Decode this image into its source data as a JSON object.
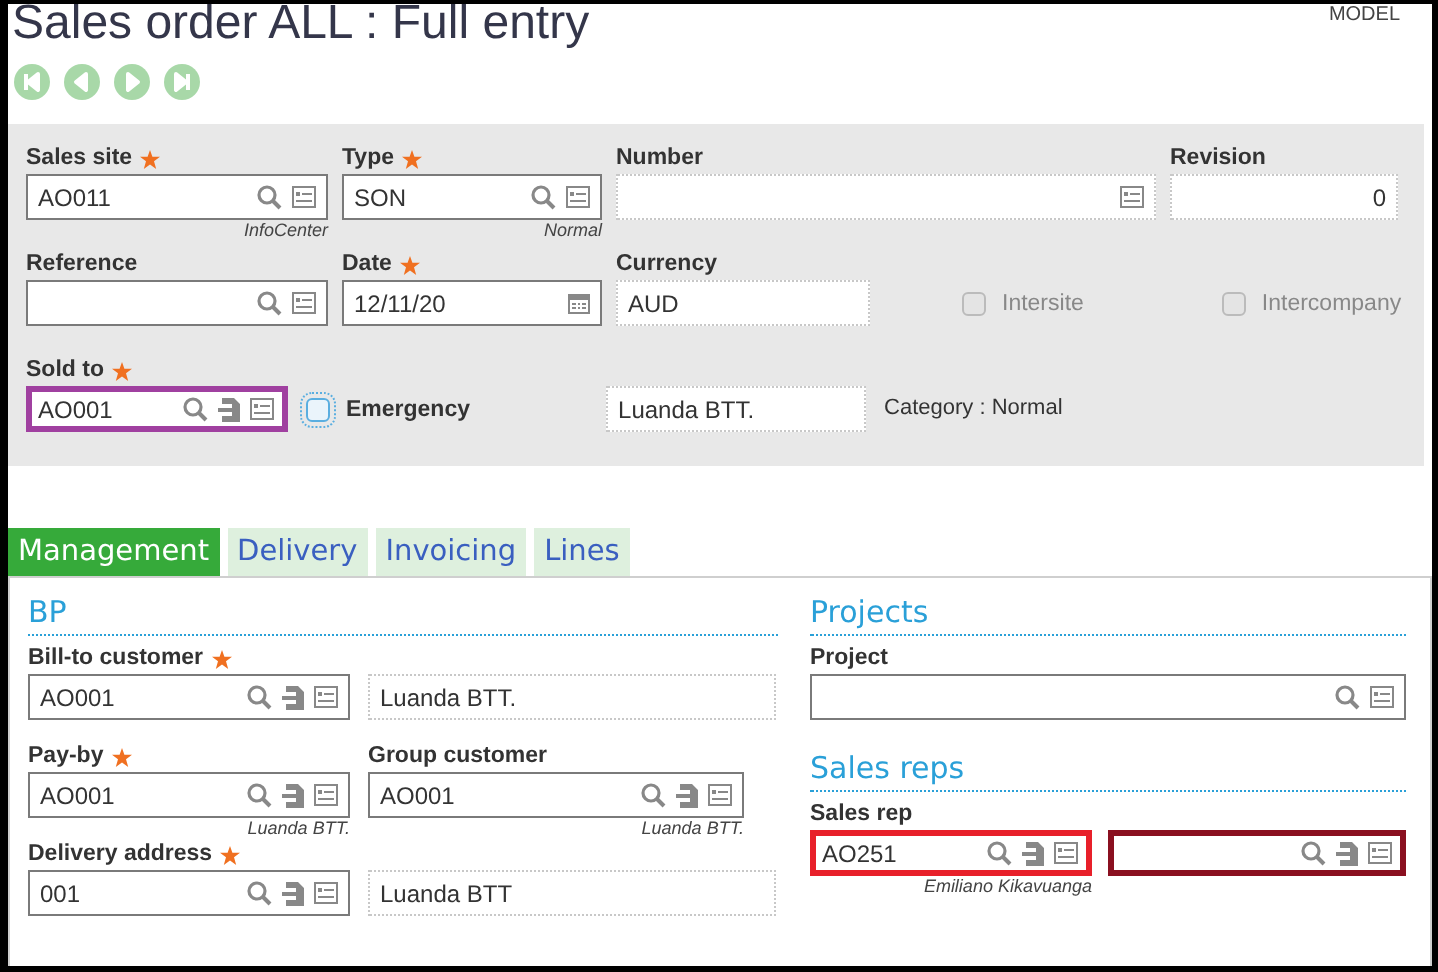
{
  "title": "Sales order ALL : Full entry",
  "model_label": "MODEL",
  "nav_buttons": [
    {
      "kind": "first"
    },
    {
      "kind": "previous"
    },
    {
      "kind": "next"
    },
    {
      "kind": "last"
    }
  ],
  "header": {
    "sales_site": {
      "label": "Sales site",
      "required": true,
      "value": "AO011",
      "kind": "lookup",
      "note": "InfoCenter"
    },
    "type": {
      "label": "Type",
      "required": true,
      "value": "SON",
      "kind": "lookup",
      "note": "Normal"
    },
    "number": {
      "label": "Number",
      "required": false,
      "kind": "readonly-detail"
    },
    "revision": {
      "label": "Revision",
      "required": false,
      "value": "0",
      "kind": "numeric"
    },
    "reference": {
      "label": "Reference",
      "required": false,
      "kind": "lookup"
    },
    "date": {
      "label": "Date",
      "required": true,
      "value": "12/11/20",
      "kind": "date"
    },
    "currency": {
      "label": "Currency",
      "required": false,
      "value": "AUD",
      "kind": "readonly"
    },
    "intersite": {
      "label": "Intersite",
      "checked": false,
      "disabled": true
    },
    "intercompany": {
      "label": "Intercompany",
      "checked": false,
      "disabled": true
    },
    "sold_to": {
      "label": "Sold to",
      "required": true,
      "value": "AO001",
      "kind": "lookup-tunnel",
      "color": "#a040a0"
    },
    "emergency": {
      "label": "Emergency",
      "checked": false,
      "disabled": false
    },
    "sold_to_name": {
      "value": "Luanda BTT.",
      "kind": "readonly"
    },
    "category": "Category : Normal"
  },
  "tabs": [
    {
      "label": "Management",
      "selected": true
    },
    {
      "label": "Delivery",
      "selected": false
    },
    {
      "label": "Invoicing",
      "selected": false
    },
    {
      "label": "Lines",
      "selected": false
    }
  ],
  "bp": {
    "title": "BP",
    "rows": [
      [
        {
          "label": "Bill-to customer",
          "required": true,
          "value": "AO001",
          "kind": "lookup-tunnel"
        },
        {
          "value": "Luanda BTT.",
          "kind": "readonly"
        }
      ],
      [
        {
          "label": "Pay-by",
          "required": true,
          "value": "AO001",
          "kind": "lookup-tunnel",
          "note": "Luanda BTT."
        },
        {
          "label": "Group customer",
          "required": false,
          "value": "AO001",
          "kind": "lookup-tunnel",
          "note": "Luanda BTT."
        }
      ],
      [
        {
          "label": "Delivery address",
          "required": true,
          "value": "001",
          "kind": "lookup-tunnel"
        },
        {
          "value": "Luanda BTT",
          "kind": "readonly"
        }
      ]
    ]
  },
  "projects": {
    "title": "Projects",
    "rows": [
      [
        {
          "label": "Project",
          "required": false,
          "kind": "lookup"
        }
      ]
    ]
  },
  "sales_reps": {
    "title": "Sales reps",
    "rows": [
      [
        {
          "label": "Sales rep",
          "required": false,
          "value": "AO251",
          "kind": "lookup-tunnel",
          "note": "Emiliano Kikavuanga",
          "color": "#e8202a"
        },
        {
          "kind": "lookup-tunnel",
          "color": "#8a1020"
        }
      ]
    ]
  }
}
